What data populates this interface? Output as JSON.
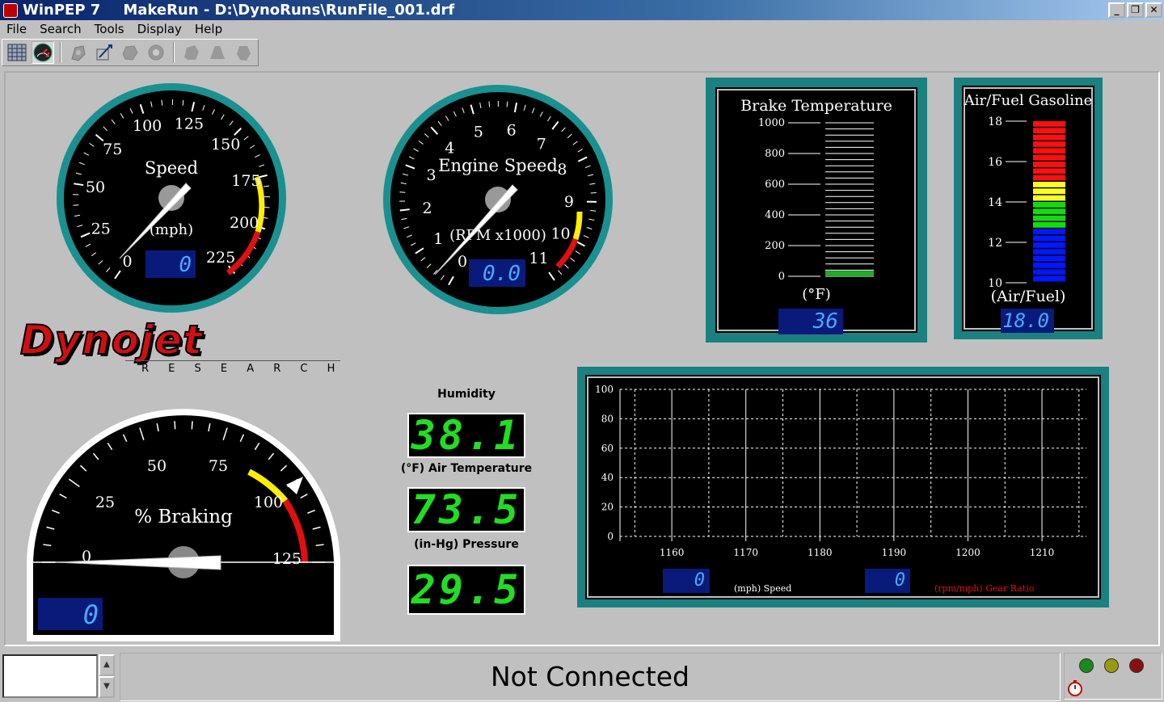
{
  "window": {
    "app_name": "WinPEP 7",
    "title": "MakeRun - D:\\DynoRuns\\RunFile_001.drf",
    "buttons": [
      "_",
      "❐",
      "✕"
    ]
  },
  "menu": [
    "File",
    "Search",
    "Tools",
    "Display",
    "Help"
  ],
  "speed_gauge": {
    "title": "Speed",
    "unit": "(mph)",
    "ticks": [
      "0",
      "25",
      "50",
      "75",
      "100",
      "125",
      "150",
      "175",
      "200",
      "225"
    ],
    "readout": "0",
    "value": 0
  },
  "engine_gauge": {
    "title": "Engine Speed",
    "unit": "(RPM x1000)",
    "ticks": [
      "0",
      "1",
      "2",
      "3",
      "4",
      "5",
      "6",
      "7",
      "8",
      "9",
      "10",
      "11"
    ],
    "readout": "0.0",
    "value": 0
  },
  "brake_temp": {
    "title": "Brake Temperature",
    "unit": "(°F)",
    "ticks": [
      "1000",
      "800",
      "600",
      "400",
      "200",
      "0"
    ],
    "readout": "36",
    "value": 36,
    "color": "#22aa22"
  },
  "air_fuel": {
    "title": "Air/Fuel Gasoline",
    "unit": "(Air/Fuel)",
    "ticks": [
      "18",
      "16",
      "14",
      "12",
      "10"
    ],
    "readout": "18.0",
    "value": 18.0
  },
  "logo": {
    "brand": "Dynojet",
    "sub": "R E S E A R C H"
  },
  "braking_gauge": {
    "title": "% Braking",
    "ticks": [
      "0",
      "25",
      "50",
      "75",
      "100",
      "125"
    ],
    "readout": "0",
    "value": 0
  },
  "environment": {
    "humidity_label": "Humidity",
    "humidity_value": "38.1",
    "air_temp_label": "(°F) Air Temperature",
    "air_temp_value": "73.5",
    "pressure_label": "(in-Hg) Pressure",
    "pressure_value": "29.5"
  },
  "chart_data": {
    "type": "line",
    "title": "",
    "xlabel": "",
    "ylabel": "",
    "x_ticks": [
      "1160",
      "1170",
      "1180",
      "1190",
      "1200",
      "1210"
    ],
    "y_ticks": [
      "100",
      "80",
      "60",
      "40",
      "20",
      "0"
    ],
    "xlim": [
      1153,
      1216
    ],
    "ylim": [
      0,
      100
    ],
    "grid": true,
    "series": [],
    "speed_readout": "0",
    "speed_label": "(mph) Speed",
    "gear_readout": "0",
    "gear_label": "(rpm/mph) Gear Ratio"
  },
  "status": {
    "text": "Not Connected",
    "lights": [
      "#1a8a1a",
      "#9a9a10",
      "#8a1010"
    ]
  }
}
